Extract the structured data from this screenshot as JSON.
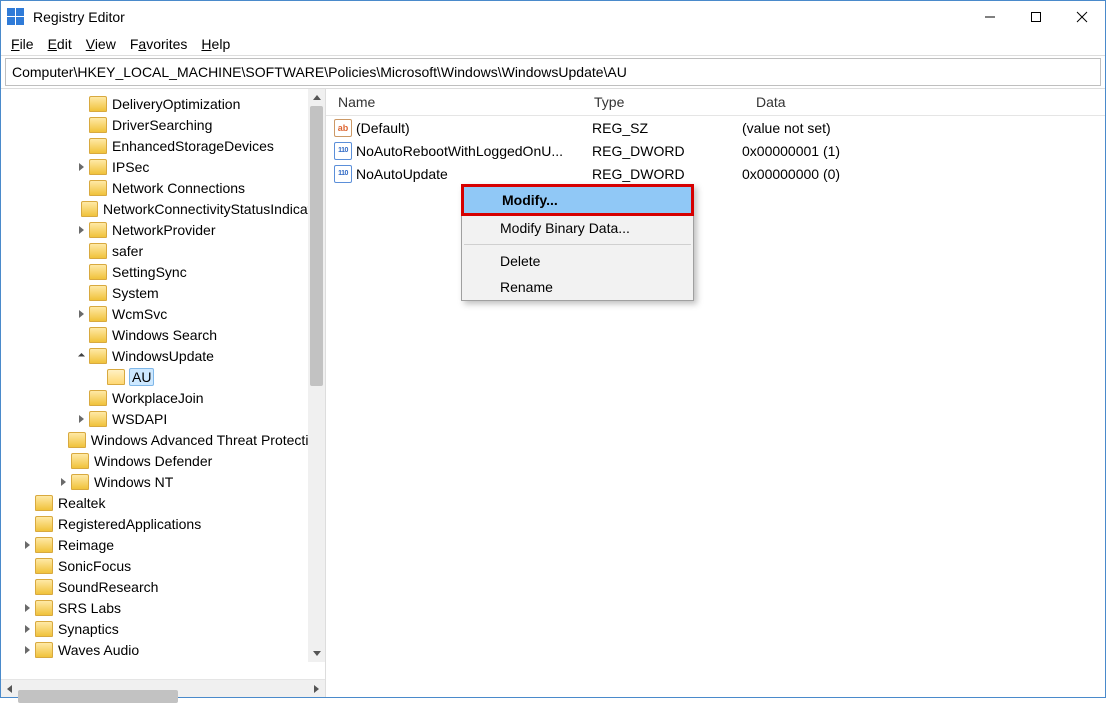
{
  "title": "Registry Editor",
  "menu": {
    "file": "File",
    "edit": "Edit",
    "view": "View",
    "favorites": "Favorites",
    "help": "Help"
  },
  "address": "Computer\\HKEY_LOCAL_MACHINE\\SOFTWARE\\Policies\\Microsoft\\Windows\\WindowsUpdate\\AU",
  "tree": [
    {
      "indent": 4,
      "tw": "",
      "label": "DeliveryOptimization"
    },
    {
      "indent": 4,
      "tw": "",
      "label": "DriverSearching"
    },
    {
      "indent": 4,
      "tw": "",
      "label": "EnhancedStorageDevices"
    },
    {
      "indent": 4,
      "tw": "r",
      "label": "IPSec"
    },
    {
      "indent": 4,
      "tw": "",
      "label": "Network Connections"
    },
    {
      "indent": 4,
      "tw": "",
      "label": "NetworkConnectivityStatusIndicator"
    },
    {
      "indent": 4,
      "tw": "r",
      "label": "NetworkProvider"
    },
    {
      "indent": 4,
      "tw": "",
      "label": "safer"
    },
    {
      "indent": 4,
      "tw": "",
      "label": "SettingSync"
    },
    {
      "indent": 4,
      "tw": "",
      "label": "System"
    },
    {
      "indent": 4,
      "tw": "r",
      "label": "WcmSvc"
    },
    {
      "indent": 4,
      "tw": "",
      "label": "Windows Search"
    },
    {
      "indent": 4,
      "tw": "d",
      "label": "WindowsUpdate"
    },
    {
      "indent": 5,
      "tw": "",
      "label": "AU",
      "sel": true,
      "open": true
    },
    {
      "indent": 4,
      "tw": "",
      "label": "WorkplaceJoin"
    },
    {
      "indent": 4,
      "tw": "r",
      "label": "WSDAPI"
    },
    {
      "indent": 3,
      "tw": "",
      "label": "Windows Advanced Threat Protection"
    },
    {
      "indent": 3,
      "tw": "",
      "label": "Windows Defender"
    },
    {
      "indent": 3,
      "tw": "r",
      "label": "Windows NT"
    },
    {
      "indent": 1,
      "tw": "",
      "label": "Realtek"
    },
    {
      "indent": 1,
      "tw": "",
      "label": "RegisteredApplications"
    },
    {
      "indent": 1,
      "tw": "r",
      "label": "Reimage"
    },
    {
      "indent": 1,
      "tw": "",
      "label": "SonicFocus"
    },
    {
      "indent": 1,
      "tw": "",
      "label": "SoundResearch"
    },
    {
      "indent": 1,
      "tw": "r",
      "label": "SRS Labs"
    },
    {
      "indent": 1,
      "tw": "r",
      "label": "Synaptics"
    },
    {
      "indent": 1,
      "tw": "r",
      "label": "Waves Audio"
    }
  ],
  "columns": {
    "name": "Name",
    "type": "Type",
    "data": "Data"
  },
  "values": [
    {
      "icon": "sz",
      "name": "(Default)",
      "type": "REG_SZ",
      "data": "(value not set)"
    },
    {
      "icon": "dw",
      "name": "NoAutoRebootWithLoggedOnU...",
      "type": "REG_DWORD",
      "data": "0x00000001 (1)"
    },
    {
      "icon": "dw",
      "name": "NoAutoUpdate",
      "type": "REG_DWORD",
      "data": "0x00000000 (0)",
      "sel": true
    }
  ],
  "ctx": {
    "modify": "Modify...",
    "modifyBinary": "Modify Binary Data...",
    "delete": "Delete",
    "rename": "Rename"
  }
}
